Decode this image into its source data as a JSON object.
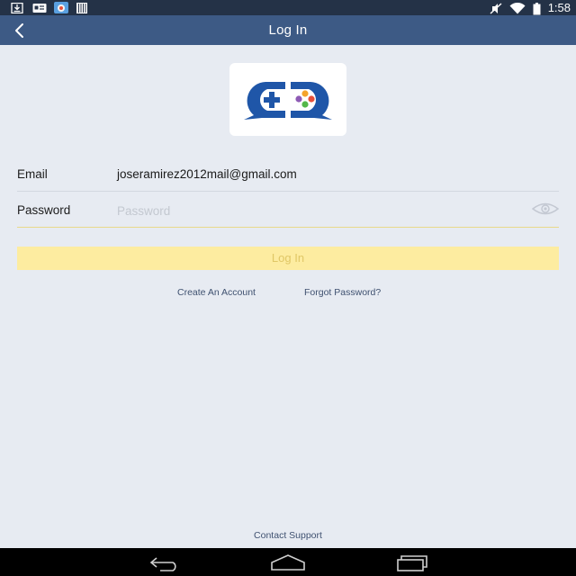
{
  "status_bar": {
    "time": "1:58",
    "icons": [
      "download-icon",
      "card-icon",
      "photo-app-icon",
      "barcode-icon",
      "mute-icon",
      "wifi-icon",
      "battery-icon"
    ]
  },
  "app_bar": {
    "title": "Log In",
    "back_icon": "chevron-left-icon"
  },
  "logo": {
    "icon": "gamepad-chat-logo",
    "colors": {
      "blue": "#1f56a8",
      "red": "#e8503a",
      "orange": "#f4a42a",
      "green": "#55b84a",
      "purple": "#8e5bb5"
    }
  },
  "form": {
    "email_label": "Email",
    "email_value": "joseramirez2012mail@gmail.com",
    "password_label": "Password",
    "password_placeholder": "Password",
    "password_value": "",
    "eye_icon": "eye-icon"
  },
  "login_button": {
    "label": "Log In",
    "background": "#fdeca0",
    "text_color": "#e0c766"
  },
  "links": {
    "create_account": "Create An Account",
    "forgot_password": "Forgot Password?",
    "contact_support": "Contact Support"
  },
  "nav_bar": {
    "icons": [
      "back-icon",
      "home-icon",
      "recent-apps-icon"
    ]
  },
  "colors": {
    "status_bar": "#243247",
    "app_bar": "#3d5a85",
    "background": "#e7ebf2"
  }
}
